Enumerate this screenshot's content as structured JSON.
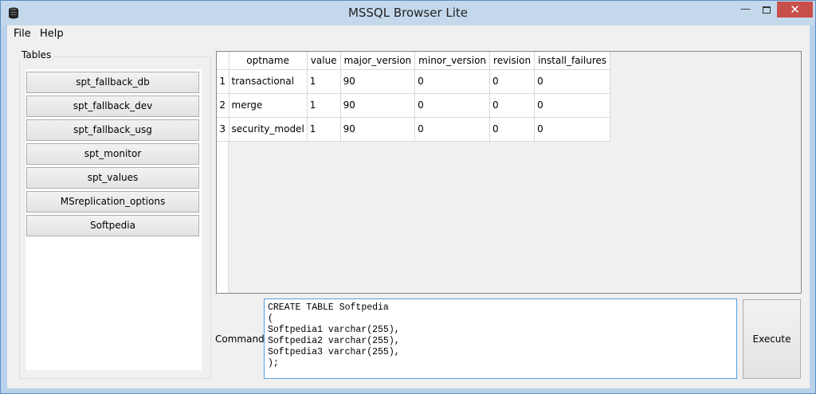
{
  "window": {
    "title": "MSSQL Browser Lite"
  },
  "menu": {
    "file": "File",
    "help": "Help"
  },
  "tables_panel": {
    "label": "Tables",
    "tables": [
      "spt_fallback_db",
      "spt_fallback_dev",
      "spt_fallback_usg",
      "spt_monitor",
      "spt_values",
      "MSreplication_options",
      "Softpedia"
    ]
  },
  "grid": {
    "columns": [
      "optname",
      "value",
      "major_version",
      "minor_version",
      "revision",
      "install_failures"
    ],
    "rows": [
      {
        "num": "1",
        "cells": [
          "transactional",
          "1",
          "90",
          "0",
          "0",
          "0"
        ]
      },
      {
        "num": "2",
        "cells": [
          "merge",
          "1",
          "90",
          "0",
          "0",
          "0"
        ]
      },
      {
        "num": "3",
        "cells": [
          "security_model",
          "1",
          "90",
          "0",
          "0",
          "0"
        ]
      }
    ]
  },
  "command": {
    "label": "Command :",
    "text": "CREATE TABLE Softpedia\n(\nSoftpedia1 varchar(255),\nSoftpedia2 varchar(255),\nSoftpedia3 varchar(255),\n);",
    "execute_label": "Execute"
  },
  "colors": {
    "window_border": "#5b8ec4",
    "close_button": "#c7504b",
    "command_border": "#569de5"
  }
}
